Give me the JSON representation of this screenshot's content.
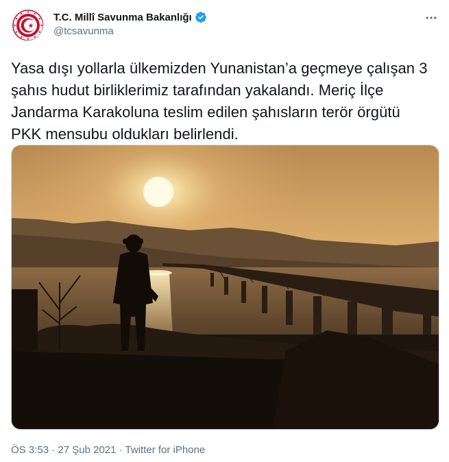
{
  "author": {
    "display_name": "T.C. Millî Savunma Bakanlığı",
    "handle": "@tcsavunma",
    "verified": true,
    "avatar_icon": "ministry-emblem-icon"
  },
  "tweet": {
    "text_lines": [
      "Yasa dışı yollarla ülkemizden Yunanistan’a geçmeye çalışan 3",
      "şahıs hudut birliklerimiz tarafından yakalandı. Meriç İlçe",
      "Jandarma Karakoluna teslim edilen şahısların terör örgütü",
      "PKK mensubu oldukları belirlendi."
    ]
  },
  "media": {
    "icon": "sunset-soldier-bridge-photo"
  },
  "meta": {
    "time": "ÖS 3:53",
    "separator_1": "·",
    "date": "27 Şub 2021",
    "separator_2": "·",
    "source": "Twitter for iPhone"
  },
  "colors": {
    "accent": "#1da1f2",
    "avatar_red": "#c8102e",
    "secondary_text": "#5b7083"
  },
  "icons": {
    "more": "more-options-icon",
    "verified": "verified-badge-icon"
  }
}
